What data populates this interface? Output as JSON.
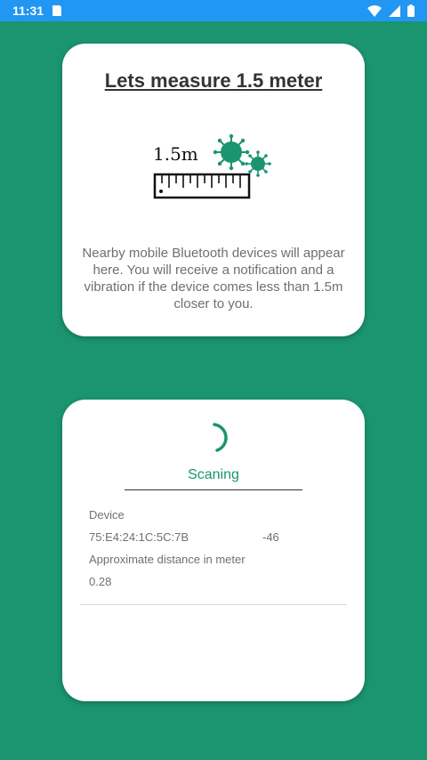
{
  "status_bar": {
    "time": "11:31",
    "left_icons": [
      "sd-card-icon"
    ],
    "right_icons": [
      "wifi-icon",
      "signal-icon",
      "battery-icon"
    ]
  },
  "intro_card": {
    "title": "Lets measure 1.5 meter",
    "illustration_text": "1.5m",
    "description": "Nearby mobile Bluetooth devices will appear here. You will receive a notification and a vibration if the device comes less than 1.5m closer to you."
  },
  "scan_card": {
    "status": "Scaning",
    "device_label": "Device",
    "device_address": "75:E4:24:1C:5C:7B",
    "rssi": "-46",
    "distance_label": "Approximate distance in meter",
    "distance_value": "0.28"
  },
  "colors": {
    "background": "#1b9470",
    "status_bar": "#2196f3",
    "accent": "#1b9470",
    "card": "#ffffff"
  }
}
